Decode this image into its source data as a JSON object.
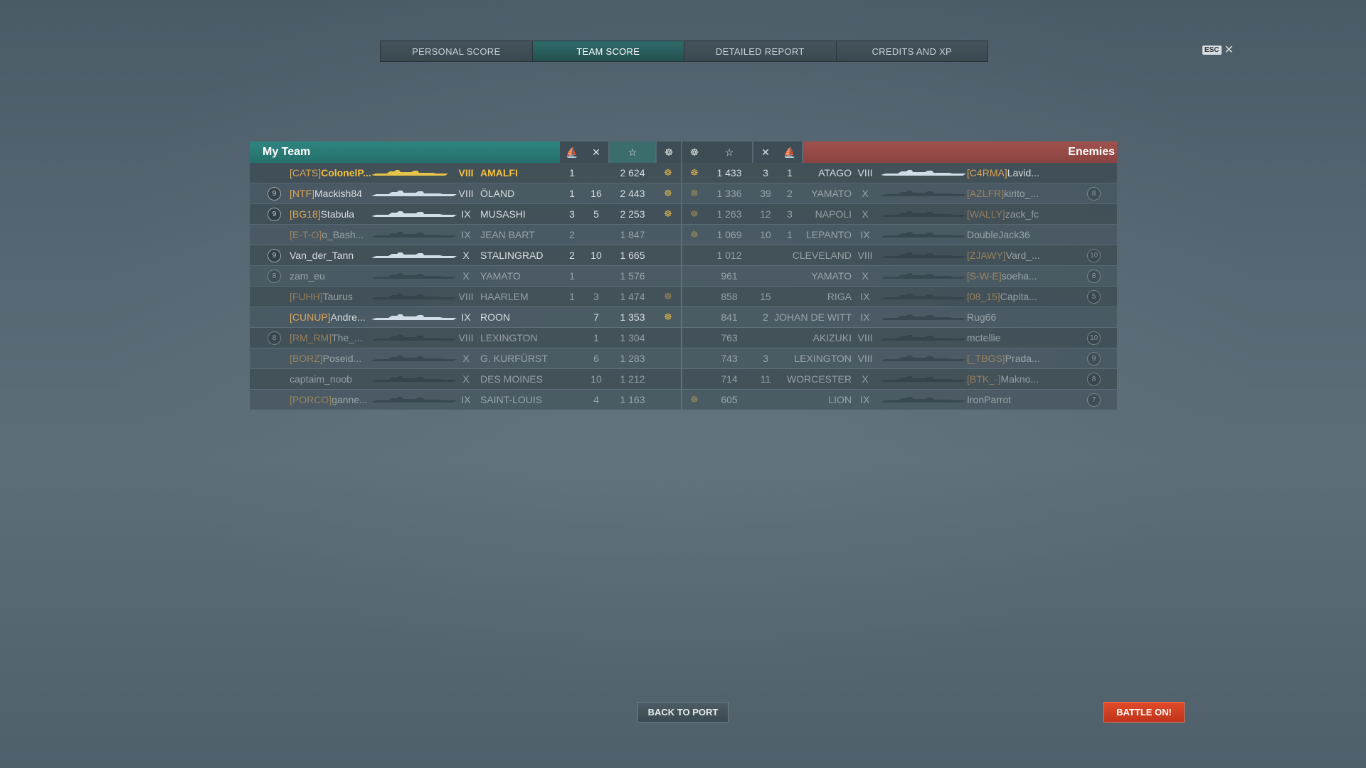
{
  "tabs": [
    "PERSONAL SCORE",
    "TEAM SCORE",
    "DETAILED REPORT",
    "CREDITS AND XP"
  ],
  "active_tab": 1,
  "esc_label": "ESC",
  "close_glyph": "✕",
  "header": {
    "my_team": "My Team",
    "enemies": "Enemies",
    "star_glyph": "☆",
    "ship_glyph": "⛵",
    "kill_glyph": "✕",
    "flag_glyph": "☸"
  },
  "my_team": [
    {
      "badge": "",
      "clan": "[CATS]",
      "name": "ColonelP...",
      "tier": "VIII",
      "ship": "AMALFI",
      "c1": "1",
      "c2": "",
      "score": "2 624",
      "flag": true,
      "me": true,
      "dead": false
    },
    {
      "badge": "9",
      "clan": "[NTF]",
      "name": "Mackish84",
      "tier": "VIII",
      "ship": "ÖLAND",
      "c1": "1",
      "c2": "16",
      "score": "2 443",
      "flag": true,
      "me": false,
      "dead": false
    },
    {
      "badge": "9",
      "clan": "[BG18]",
      "name": "Stabula",
      "tier": "IX",
      "ship": "MUSASHI",
      "c1": "3",
      "c2": "5",
      "score": "2 253",
      "flag": true,
      "me": false,
      "dead": false
    },
    {
      "badge": "",
      "clan": "[E-T-O]",
      "name": "o_Bash...",
      "tier": "IX",
      "ship": "JEAN BART",
      "c1": "2",
      "c2": "",
      "score": "1 847",
      "flag": false,
      "me": false,
      "dead": true
    },
    {
      "badge": "9",
      "clan": "",
      "name": "Van_der_Tann",
      "tier": "X",
      "ship": "STALINGRAD",
      "c1": "2",
      "c2": "10",
      "score": "1 665",
      "flag": false,
      "me": false,
      "dead": false
    },
    {
      "badge": "8",
      "clan": "",
      "name": "zam_eu",
      "tier": "X",
      "ship": "YAMATO",
      "c1": "1",
      "c2": "",
      "score": "1 576",
      "flag": false,
      "me": false,
      "dead": true
    },
    {
      "badge": "",
      "clan": "[FUHH]",
      "name": "Taurus",
      "tier": "VIII",
      "ship": "HAARLEM",
      "c1": "1",
      "c2": "3",
      "score": "1 474",
      "flag": true,
      "me": false,
      "dead": true
    },
    {
      "badge": "",
      "clan": "[CUNUP]",
      "name": "Andre...",
      "tier": "IX",
      "ship": "ROON",
      "c1": "",
      "c2": "7",
      "score": "1 353",
      "flag": true,
      "me": false,
      "dead": false
    },
    {
      "badge": "8",
      "clan": "[RM_RM]",
      "name": "The_...",
      "tier": "VIII",
      "ship": "LEXINGTON",
      "c1": "",
      "c2": "1",
      "score": "1 304",
      "flag": false,
      "me": false,
      "dead": true
    },
    {
      "badge": "",
      "clan": "[BORZ]",
      "name": "Poseid...",
      "tier": "X",
      "ship": "G. KURFÜRST",
      "c1": "",
      "c2": "6",
      "score": "1 283",
      "flag": false,
      "me": false,
      "dead": true
    },
    {
      "badge": "",
      "clan": "",
      "name": "captaim_noob",
      "tier": "X",
      "ship": "DES MOINES",
      "c1": "",
      "c2": "10",
      "score": "1 212",
      "flag": false,
      "me": false,
      "dead": true
    },
    {
      "badge": "",
      "clan": "[PORCO]",
      "name": "ganne...",
      "tier": "IX",
      "ship": "SAINT-LOUIS",
      "c1": "",
      "c2": "4",
      "score": "1 163",
      "flag": false,
      "me": false,
      "dead": true
    }
  ],
  "enemies": [
    {
      "flag": true,
      "score": "1 433",
      "c2": "3",
      "c1": "1",
      "ship": "ATAGO",
      "tier": "VIII",
      "clan": "[C4RMA]",
      "name": "Lavid...",
      "badge": "",
      "dead": false
    },
    {
      "flag": true,
      "score": "1 336",
      "c2": "39",
      "c1": "2",
      "ship": "YAMATO",
      "tier": "X",
      "clan": "[AZLFR]",
      "name": "kirito_...",
      "badge": "8",
      "dead": true
    },
    {
      "flag": true,
      "score": "1 263",
      "c2": "12",
      "c1": "3",
      "ship": "NAPOLI",
      "tier": "X",
      "clan": "[WALLY]",
      "name": "zack_fc",
      "badge": "",
      "dead": true
    },
    {
      "flag": true,
      "score": "1 069",
      "c2": "10",
      "c1": "1",
      "ship": "LEPANTO",
      "tier": "IX",
      "clan": "",
      "name": "DoubleJack36",
      "badge": "",
      "dead": true
    },
    {
      "flag": false,
      "score": "1 012",
      "c2": "",
      "c1": "",
      "ship": "CLEVELAND",
      "tier": "VIII",
      "clan": "[ZJAWY]",
      "name": "Vard_...",
      "badge": "10",
      "dead": true
    },
    {
      "flag": false,
      "score": "961",
      "c2": "",
      "c1": "",
      "ship": "YAMATO",
      "tier": "X",
      "clan": "[S-W-E]",
      "name": "soeha...",
      "badge": "8",
      "dead": true
    },
    {
      "flag": false,
      "score": "858",
      "c2": "15",
      "c1": "",
      "ship": "RIGA",
      "tier": "IX",
      "clan": "[08_15]",
      "name": "Capita...",
      "badge": "5",
      "dead": true
    },
    {
      "flag": false,
      "score": "841",
      "c2": "2",
      "c1": "",
      "ship": "JOHAN DE WITT",
      "tier": "IX",
      "clan": "",
      "name": "Rug66",
      "badge": "",
      "dead": true
    },
    {
      "flag": false,
      "score": "763",
      "c2": "",
      "c1": "",
      "ship": "AKIZUKI",
      "tier": "VIII",
      "clan": "",
      "name": "mctellie",
      "badge": "10",
      "dead": true
    },
    {
      "flag": false,
      "score": "743",
      "c2": "3",
      "c1": "",
      "ship": "LEXINGTON",
      "tier": "VIII",
      "clan": "[_TBGS]",
      "name": "Prada...",
      "badge": "9",
      "dead": true
    },
    {
      "flag": false,
      "score": "714",
      "c2": "11",
      "c1": "",
      "ship": "WORCESTER",
      "tier": "X",
      "clan": "[BTK_-]",
      "name": "Makno...",
      "badge": "8",
      "dead": true
    },
    {
      "flag": true,
      "score": "605",
      "c2": "",
      "c1": "",
      "ship": "LION",
      "tier": "IX",
      "clan": "",
      "name": "IronParrot",
      "badge": "7",
      "dead": true
    }
  ],
  "buttons": {
    "back_to_port": "BACK TO PORT",
    "battle_on": "BATTLE ON!"
  },
  "colors": {
    "my_team": "#2f8580",
    "enemies": "#a0514d",
    "clan": "#d9a35a",
    "self": "#f0c040",
    "battle_on": "#e04a2a"
  }
}
